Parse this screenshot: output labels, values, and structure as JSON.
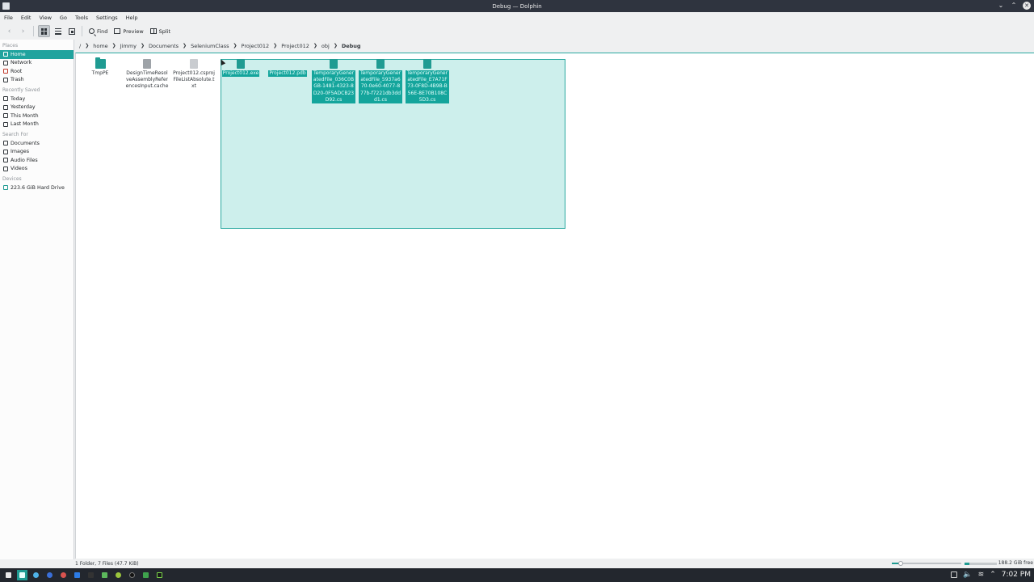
{
  "window": {
    "title": "Debug — Dolphin"
  },
  "menu": [
    "File",
    "Edit",
    "View",
    "Go",
    "Tools",
    "Settings",
    "Help"
  ],
  "toolbar": {
    "find": "Find",
    "preview": "Preview",
    "split": "Split"
  },
  "breadcrumb": [
    "home",
    "Jimmy",
    "Documents",
    "SeleniumClass",
    "Project012",
    "Project012",
    "obj",
    "Debug"
  ],
  "breadcrumb_root": "/",
  "sidebar": {
    "places_title": "Places",
    "places": [
      "Home",
      "Network",
      "Root",
      "Trash"
    ],
    "recent_title": "Recently Saved",
    "recent": [
      "Today",
      "Yesterday",
      "This Month",
      "Last Month"
    ],
    "search_title": "Search For",
    "search": [
      "Documents",
      "Images",
      "Audio Files",
      "Videos"
    ],
    "devices_title": "Devices",
    "devices": [
      "223.6 GiB Hard Drive"
    ]
  },
  "files": [
    {
      "name": "TmpPE",
      "type": "folder",
      "selected": false
    },
    {
      "name": "DesignTimeResolveAssemblyReferencesInput.cache",
      "type": "file",
      "selected": false
    },
    {
      "name": "Project012.csprojFileListAbsolute.txt",
      "type": "file",
      "selected": false
    },
    {
      "name": "Project012.exe",
      "type": "file",
      "selected": true
    },
    {
      "name": "Project012.pdb",
      "type": "file",
      "selected": true
    },
    {
      "name": "TemporaryGeneratedFile_036C0BGB-1481-4323-8D20-0F5ADCB23D92.cs",
      "type": "file",
      "selected": true
    },
    {
      "name": "TemporaryGeneratedFile_5937a670-0e60-4077-877b-f7221db3ddd1.cs",
      "type": "file",
      "selected": true
    },
    {
      "name": "TemporaryGeneratedFile_E7A71F73-0F8D-4B9B-B56E-8E70B108C5D3.cs",
      "type": "file",
      "selected": true
    }
  ],
  "status": {
    "summary": "1 Folder, 7 Files (47.7 KiB)",
    "free": "188.2 GiB free"
  },
  "clock": "7:02 PM",
  "colors": {
    "accent": "#1f9b92",
    "selection": "#14a59c",
    "titlebar": "#2f343f",
    "taskbar": "#23272e"
  }
}
